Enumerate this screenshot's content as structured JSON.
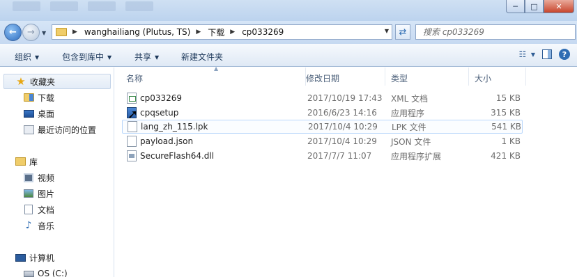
{
  "window": {
    "controls": {
      "minimize": "─",
      "maximize": "□",
      "close": "✕"
    }
  },
  "address": {
    "breadcrumbs": [
      "wanghailiang (Plutus, TS)",
      "下载",
      "cp033269"
    ],
    "search_placeholder": "搜索 cp033269"
  },
  "toolbar": {
    "organize": "组织",
    "include_in_library": "包含到库中",
    "share": "共享",
    "new_folder": "新建文件夹"
  },
  "sidebar": {
    "favorites_header": "收藏夹",
    "favorites": [
      {
        "label": "下载",
        "icon": "download-folder-icon"
      },
      {
        "label": "桌面",
        "icon": "desktop-icon"
      },
      {
        "label": "最近访问的位置",
        "icon": "recent-places-icon"
      }
    ],
    "libraries_header": "库",
    "libraries": [
      {
        "label": "视频",
        "icon": "videos-icon"
      },
      {
        "label": "图片",
        "icon": "pictures-icon"
      },
      {
        "label": "文档",
        "icon": "documents-icon"
      },
      {
        "label": "音乐",
        "icon": "music-icon"
      }
    ],
    "computer_header": "计算机",
    "drives": [
      {
        "label": "OS (C:)",
        "icon": "drive-icon"
      }
    ]
  },
  "columns": {
    "name": "名称",
    "date": "修改日期",
    "type": "类型",
    "size": "大小"
  },
  "files": [
    {
      "name": "cp033269",
      "date": "2017/10/19 17:43",
      "type": "XML 文档",
      "size": "15 KB",
      "icon": "xml-file-icon"
    },
    {
      "name": "cpqsetup",
      "date": "2016/6/23 14:16",
      "type": "应用程序",
      "size": "315 KB",
      "icon": "exe-file-icon"
    },
    {
      "name": "lang_zh_115.lpk",
      "date": "2017/10/4 10:29",
      "type": "LPK 文件",
      "size": "541 KB",
      "icon": "lpk-file-icon"
    },
    {
      "name": "payload.json",
      "date": "2017/10/4 10:29",
      "type": "JSON 文件",
      "size": "1 KB",
      "icon": "json-file-icon"
    },
    {
      "name": "SecureFlash64.dll",
      "date": "2017/7/7 11:07",
      "type": "应用程序扩展",
      "size": "421 KB",
      "icon": "dll-file-icon"
    }
  ]
}
